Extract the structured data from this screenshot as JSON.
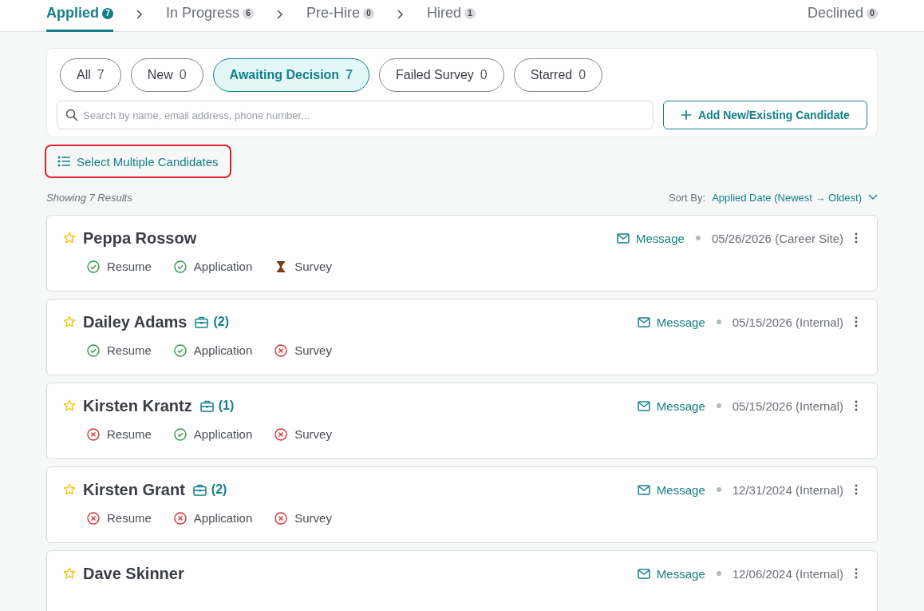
{
  "stages": [
    {
      "label": "Applied",
      "count": "7",
      "selected": true
    },
    {
      "label": "In Progress",
      "count": "6",
      "selected": false
    },
    {
      "label": "Pre-Hire",
      "count": "0",
      "selected": false
    },
    {
      "label": "Hired",
      "count": "1",
      "selected": false
    }
  ],
  "declined": {
    "label": "Declined",
    "count": "0",
    "selected": false
  },
  "filters": [
    {
      "label": "All",
      "count": "7",
      "selected": false
    },
    {
      "label": "New",
      "count": "0",
      "selected": false
    },
    {
      "label": "Awaiting Decision",
      "count": "7",
      "selected": true
    },
    {
      "label": "Failed Survey",
      "count": "0",
      "selected": false
    },
    {
      "label": "Starred",
      "count": "0",
      "selected": false
    }
  ],
  "search": {
    "placeholder": "Search by name, email address, phone number..."
  },
  "add_button": "Add New/Existing Candidate",
  "select_multiple": {
    "label": "Select Multiple Candidates",
    "focused": true
  },
  "results_text": "Showing 7 Results",
  "sort": {
    "label": "Sort By:",
    "value": "Applied Date (Newest → Oldest)"
  },
  "candidates": [
    {
      "name": "Peppa Rossow",
      "starred": false,
      "message": "Message",
      "date": "05/26/2026 (Career Site)",
      "checks": [
        {
          "label": "Resume",
          "kind": "done"
        },
        {
          "label": "Application",
          "kind": "done"
        },
        {
          "label": "Survey",
          "kind": "pending"
        }
      ]
    },
    {
      "name": "Dailey Adams",
      "starred": false,
      "jobs": "(2)",
      "message": "Message",
      "date": "05/15/2026 (Internal)",
      "checks": [
        {
          "label": "Resume",
          "kind": "done"
        },
        {
          "label": "Application",
          "kind": "done"
        },
        {
          "label": "Survey",
          "kind": "failed"
        }
      ]
    },
    {
      "name": "Kirsten Krantz",
      "starred": false,
      "jobs": "(1)",
      "message": "Message",
      "date": "05/15/2026 (Internal)",
      "checks": [
        {
          "label": "Resume",
          "kind": "failed"
        },
        {
          "label": "Application",
          "kind": "done"
        },
        {
          "label": "Survey",
          "kind": "failed"
        }
      ]
    },
    {
      "name": "Kirsten Grant",
      "starred": false,
      "jobs": "(2)",
      "message": "Message",
      "date": "12/31/2024 (Internal)",
      "checks": [
        {
          "label": "Resume",
          "kind": "failed"
        },
        {
          "label": "Application",
          "kind": "failed"
        },
        {
          "label": "Survey",
          "kind": "failed"
        }
      ]
    },
    {
      "name": "Dave Skinner",
      "starred": false,
      "message": "Message",
      "date": "12/06/2024 (Internal)"
    }
  ]
}
